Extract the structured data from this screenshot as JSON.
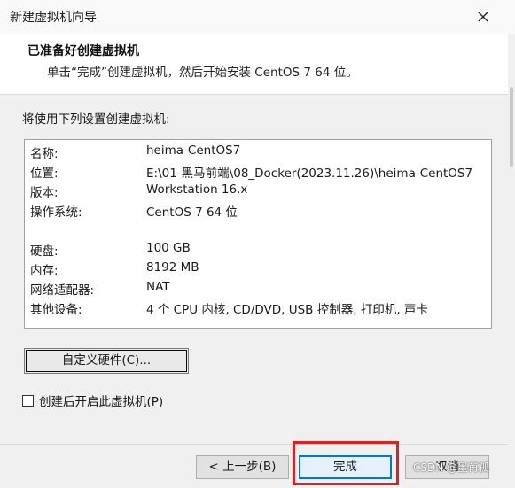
{
  "window": {
    "title": "新建虚拟机向导",
    "close_icon": "close-icon"
  },
  "header": {
    "title": "已准备好创建虚拟机",
    "subtitle": "单击“完成”创建虚拟机，然后开始安装 CentOS 7 64 位。"
  },
  "summary": {
    "label": "将使用下列设置创建虚拟机:",
    "rows": [
      {
        "key": "名称:",
        "value": "heima-CentOS7"
      },
      {
        "key": "位置:",
        "value": "E:\\01-黑马前端\\08_Docker(2023.11.26)\\heima-CentOS7"
      },
      {
        "key": "版本:",
        "value": "Workstation 16.x"
      },
      {
        "key": "操作系统:",
        "value": "CentOS 7 64 位"
      },
      {
        "key": "硬盘:",
        "value": "100 GB"
      },
      {
        "key": "内存:",
        "value": "8192 MB"
      },
      {
        "key": "网络适配器:",
        "value": "NAT"
      },
      {
        "key": "其他设备:",
        "value": "4 个 CPU 内核, CD/DVD, USB 控制器, 打印机, 声卡"
      }
    ]
  },
  "customize_button": "自定义硬件(C)...",
  "power_on_checkbox": {
    "label": "创建后开启此虚拟机(P)",
    "checked": false
  },
  "footer": {
    "back_label": "< 上一步(B)",
    "finish_label": "完成",
    "cancel_label": "取消"
  },
  "watermark": "CSDN @墨苒孤",
  "colors": {
    "accent": "#0078d7",
    "highlight": "#e02020"
  }
}
